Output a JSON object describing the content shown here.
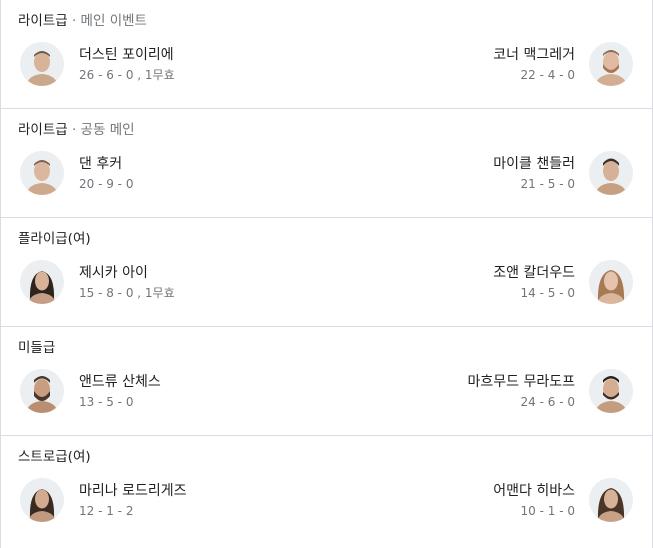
{
  "bouts": [
    {
      "division": "라이트급",
      "sub": " · 메인 이벤트",
      "left": {
        "name": "더스틴 포이리에",
        "record": "26 - 6 - 0 , 1무효",
        "avatar_icon": "fighter-photo"
      },
      "right": {
        "name": "코너 맥그레거",
        "record": "22 - 4 - 0",
        "avatar_icon": "fighter-photo"
      }
    },
    {
      "division": "라이트급",
      "sub": " · 공동 메인",
      "left": {
        "name": "댄 후커",
        "record": "20 - 9 - 0",
        "avatar_icon": "fighter-photo"
      },
      "right": {
        "name": "마이클 챈들러",
        "record": "21 - 5 - 0",
        "avatar_icon": "fighter-photo"
      }
    },
    {
      "division": "플라이급(여)",
      "sub": "",
      "left": {
        "name": "제시카 아이",
        "record": "15 - 8 - 0 , 1무효",
        "avatar_icon": "fighter-photo"
      },
      "right": {
        "name": "조앤 칼더우드",
        "record": "14 - 5 - 0",
        "avatar_icon": "fighter-photo"
      }
    },
    {
      "division": "미들급",
      "sub": "",
      "left": {
        "name": "앤드류 산체스",
        "record": "13 - 5 - 0",
        "avatar_icon": "fighter-photo"
      },
      "right": {
        "name": "마흐무드 무라도프",
        "record": "24 - 6 - 0",
        "avatar_icon": "fighter-photo"
      }
    },
    {
      "division": "스트로급(여)",
      "sub": "",
      "left": {
        "name": "마리나 로드리게즈",
        "record": "12 - 1 - 2",
        "avatar_icon": "fighter-photo"
      },
      "right": {
        "name": "어맨다 히바스",
        "record": "10 - 1 - 0",
        "avatar_icon": "fighter-photo"
      }
    }
  ]
}
